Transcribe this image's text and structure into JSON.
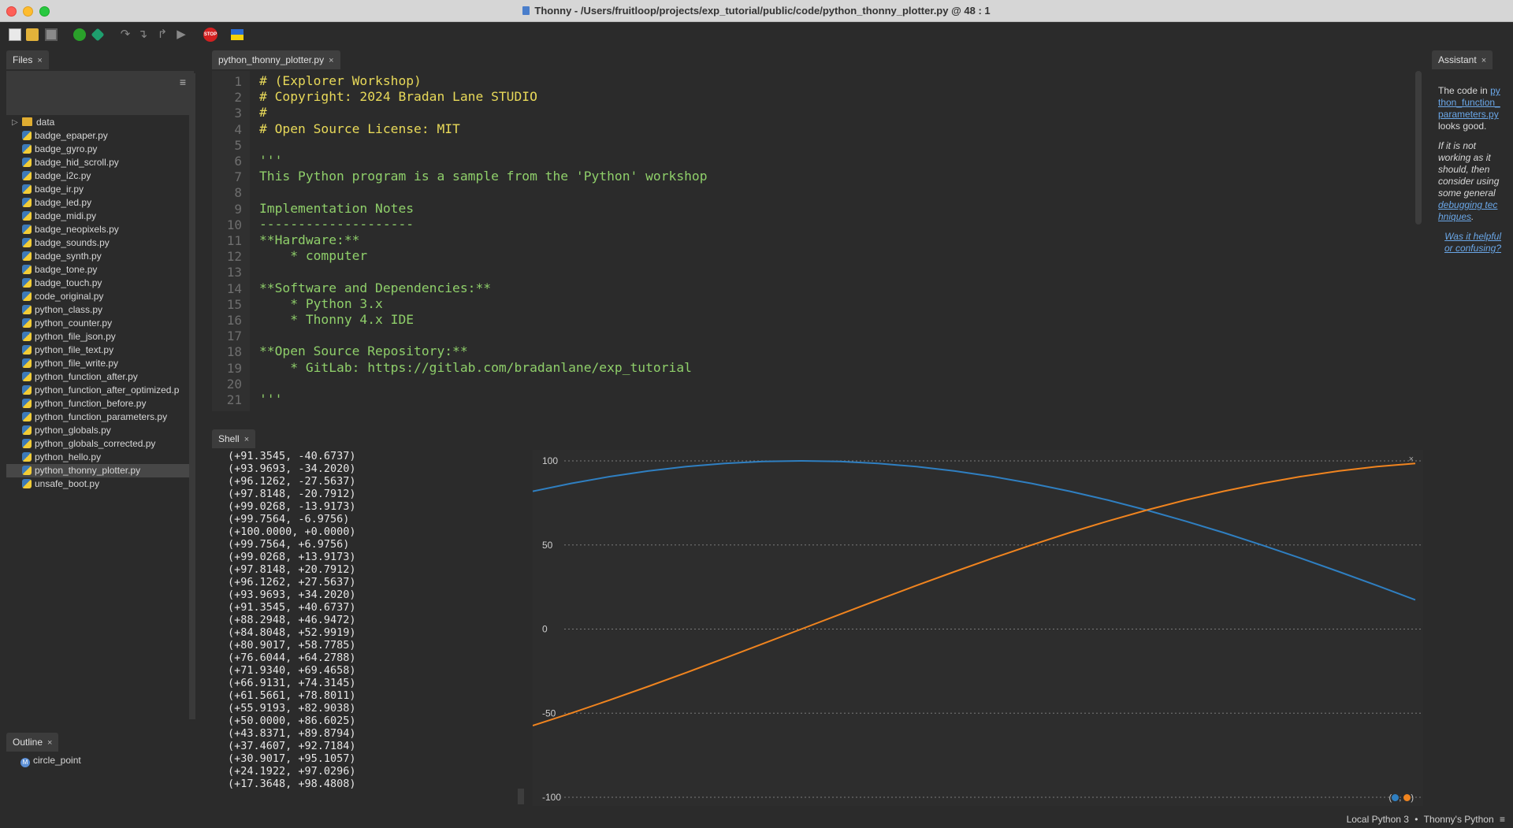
{
  "window": {
    "title": "Thonny  -  /Users/fruitloop/projects/exp_tutorial/public/code/python_thonny_plotter.py  @  48 : 1"
  },
  "toolbar": {
    "icons": [
      "new-file-icon",
      "open-file-icon",
      "save-file-icon",
      "run-icon",
      "debug-icon",
      "step-over-icon",
      "step-into-icon",
      "step-out-icon",
      "resume-icon",
      "stop-icon",
      "ukraine-flag-icon"
    ],
    "stop_label": "STOP"
  },
  "files": {
    "tab_label": "Files",
    "close": "×",
    "menu_glyph": "≡",
    "items": [
      {
        "name": "data",
        "type": "folder"
      },
      {
        "name": "badge_epaper.py",
        "type": "file"
      },
      {
        "name": "badge_gyro.py",
        "type": "file"
      },
      {
        "name": "badge_hid_scroll.py",
        "type": "file"
      },
      {
        "name": "badge_i2c.py",
        "type": "file"
      },
      {
        "name": "badge_ir.py",
        "type": "file"
      },
      {
        "name": "badge_led.py",
        "type": "file"
      },
      {
        "name": "badge_midi.py",
        "type": "file"
      },
      {
        "name": "badge_neopixels.py",
        "type": "file"
      },
      {
        "name": "badge_sounds.py",
        "type": "file"
      },
      {
        "name": "badge_synth.py",
        "type": "file"
      },
      {
        "name": "badge_tone.py",
        "type": "file"
      },
      {
        "name": "badge_touch.py",
        "type": "file"
      },
      {
        "name": "code_original.py",
        "type": "file"
      },
      {
        "name": "python_class.py",
        "type": "file"
      },
      {
        "name": "python_counter.py",
        "type": "file"
      },
      {
        "name": "python_file_json.py",
        "type": "file"
      },
      {
        "name": "python_file_text.py",
        "type": "file"
      },
      {
        "name": "python_file_write.py",
        "type": "file"
      },
      {
        "name": "python_function_after.py",
        "type": "file"
      },
      {
        "name": "python_function_after_optimized.p",
        "type": "file"
      },
      {
        "name": "python_function_before.py",
        "type": "file"
      },
      {
        "name": "python_function_parameters.py",
        "type": "file"
      },
      {
        "name": "python_globals.py",
        "type": "file"
      },
      {
        "name": "python_globals_corrected.py",
        "type": "file"
      },
      {
        "name": "python_hello.py",
        "type": "file"
      },
      {
        "name": "python_thonny_plotter.py",
        "type": "file",
        "selected": true
      },
      {
        "name": "unsafe_boot.py",
        "type": "file"
      }
    ]
  },
  "outline": {
    "tab_label": "Outline",
    "close": "×",
    "items": [
      {
        "name": "circle_point"
      }
    ]
  },
  "editor": {
    "tab_label": "python_thonny_plotter.py",
    "close": "×",
    "lines": [
      {
        "n": "1",
        "text": "# (Explorer Workshop)",
        "kind": "comment"
      },
      {
        "n": "2",
        "text": "# Copyright: 2024 Bradan Lane STUDIO",
        "kind": "comment"
      },
      {
        "n": "3",
        "text": "#",
        "kind": "comment"
      },
      {
        "n": "4",
        "text": "# Open Source License: MIT",
        "kind": "comment"
      },
      {
        "n": "5",
        "text": "",
        "kind": "string"
      },
      {
        "n": "6",
        "text": "'''",
        "kind": "string"
      },
      {
        "n": "7",
        "text": "This Python program is a sample from the 'Python' workshop",
        "kind": "string"
      },
      {
        "n": "8",
        "text": "",
        "kind": "string"
      },
      {
        "n": "9",
        "text": "Implementation Notes",
        "kind": "string"
      },
      {
        "n": "10",
        "text": "--------------------",
        "kind": "string"
      },
      {
        "n": "11",
        "text": "**Hardware:**",
        "kind": "string"
      },
      {
        "n": "12",
        "text": "    * computer",
        "kind": "string"
      },
      {
        "n": "13",
        "text": "",
        "kind": "string"
      },
      {
        "n": "14",
        "text": "**Software and Dependencies:**",
        "kind": "string"
      },
      {
        "n": "15",
        "text": "    * Python 3.x",
        "kind": "string"
      },
      {
        "n": "16",
        "text": "    * Thonny 4.x IDE",
        "kind": "string"
      },
      {
        "n": "17",
        "text": "",
        "kind": "string"
      },
      {
        "n": "18",
        "text": "**Open Source Repository:**",
        "kind": "string"
      },
      {
        "n": "19",
        "text": "    * GitLab: https://gitlab.com/bradanlane/exp_tutorial",
        "kind": "string"
      },
      {
        "n": "20",
        "text": "",
        "kind": "string"
      },
      {
        "n": "21",
        "text": "'''",
        "kind": "string"
      }
    ]
  },
  "shell": {
    "tab_label": "Shell",
    "close": "×",
    "lines": [
      "(+91.3545, -40.6737)",
      "(+93.9693, -34.2020)",
      "(+96.1262, -27.5637)",
      "(+97.8148, -20.7912)",
      "(+99.0268, -13.9173)",
      "(+99.7564, -6.9756)",
      "(+100.0000, +0.0000)",
      "(+99.7564, +6.9756)",
      "(+99.0268, +13.9173)",
      "(+97.8148, +20.7912)",
      "(+96.1262, +27.5637)",
      "(+93.9693, +34.2020)",
      "(+91.3545, +40.6737)",
      "(+88.2948, +46.9472)",
      "(+84.8048, +52.9919)",
      "(+80.9017, +58.7785)",
      "(+76.6044, +64.2788)",
      "(+71.9340, +69.4658)",
      "(+66.9131, +74.3145)",
      "(+61.5661, +78.8011)",
      "(+55.9193, +82.9038)",
      "(+50.0000, +86.6025)",
      "(+43.8371, +89.8794)",
      "(+37.4607, +92.7184)",
      "(+30.9017, +95.1057)",
      "(+24.1922, +97.0296)",
      "(+17.3648, +98.4808)"
    ]
  },
  "chart_data": {
    "type": "line",
    "ylim": [
      -100,
      100
    ],
    "yticks": [
      "100",
      "50",
      "0",
      "-50",
      "-100"
    ],
    "ytick_values": [
      100,
      50,
      0,
      -50,
      -100
    ],
    "series": [
      {
        "color": "#2f7fc1",
        "values": [
          81.9152,
          86.6025,
          90.6308,
          93.9693,
          96.5926,
          98.4808,
          99.6195,
          100.0,
          99.6195,
          98.4808,
          96.5926,
          93.9693,
          90.6308,
          86.6025,
          81.9152,
          76.6044,
          70.7107,
          64.2788,
          57.3576,
          50.0,
          42.2618,
          34.202,
          25.8819,
          17.3648
        ]
      },
      {
        "color": "#f0841f",
        "values": [
          -57.3576,
          -50.0,
          -42.2618,
          -34.202,
          -25.8819,
          -17.3648,
          -8.7156,
          0.0,
          8.7156,
          17.3648,
          25.8819,
          34.202,
          42.2618,
          50.0,
          57.3576,
          64.2788,
          70.7107,
          76.6044,
          81.9152,
          86.6025,
          90.6308,
          93.9693,
          96.5926,
          98.4808
        ]
      }
    ],
    "legend_text": "(●, ●)",
    "close": "×"
  },
  "assistant": {
    "tab_label": "Assistant",
    "close": "×",
    "msg_prefix": "The code in",
    "msg_file": "python_function_parameters.py",
    "msg_suffix": "looks good.",
    "hint_prefix": "If it is not working as it should, then consider using some general",
    "hint_link": "debugging techniques",
    "hint_end": ".",
    "feedback_link": "Was it helpful or confusing?"
  },
  "status": {
    "interpreter": "Local Python 3",
    "separator": "•",
    "backend": "Thonny's Python",
    "menu": "≡"
  }
}
